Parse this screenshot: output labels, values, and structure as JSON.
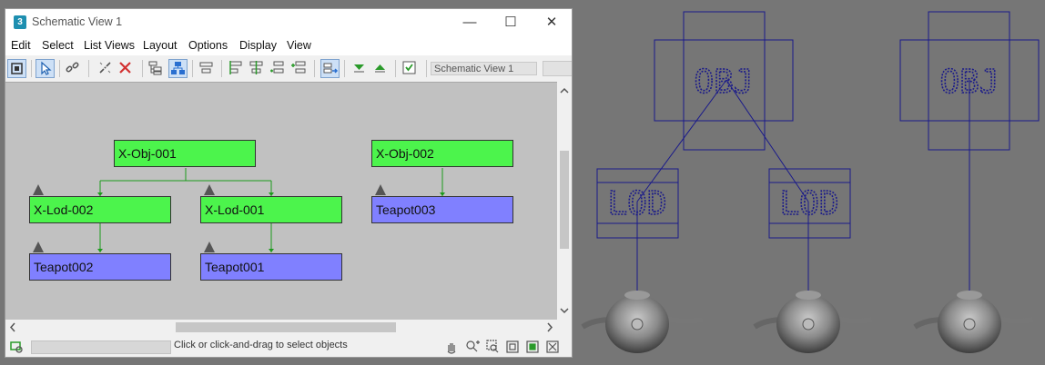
{
  "window": {
    "title": "Schematic View 1",
    "app_icon_label": "3",
    "minimize_glyph": "—",
    "maximize_glyph": "☐",
    "close_glyph": "✕"
  },
  "menu": [
    "Edit",
    "Select",
    "List Views",
    "Layout",
    "Options",
    "Display",
    "View"
  ],
  "toolbar": {
    "view_name": "Schematic View 1",
    "buttons": [
      "display-floater-icon",
      "select-icon",
      "connect-icon",
      "unlink-icon",
      "delete-icon",
      "hierarchy-mode-icon",
      "references-mode-icon",
      "align-icon",
      "align-left-icon",
      "align-center-icon",
      "insert-branch-icon",
      "insert-node-icon",
      "preferences-icon",
      "expand-icon",
      "collapse-icon",
      "filter-icon"
    ]
  },
  "schematic": {
    "nodes": [
      {
        "id": "x-obj-001",
        "label": "X-Obj-001",
        "kind": "object"
      },
      {
        "id": "x-lod-002",
        "label": "X-Lod-002",
        "kind": "object"
      },
      {
        "id": "x-lod-001",
        "label": "X-Lod-001",
        "kind": "object"
      },
      {
        "id": "teapot002",
        "label": "Teapot002",
        "kind": "geometry"
      },
      {
        "id": "teapot001",
        "label": "Teapot001",
        "kind": "geometry"
      },
      {
        "id": "x-obj-002",
        "label": "X-Obj-002",
        "kind": "object"
      },
      {
        "id": "teapot003",
        "label": "Teapot003",
        "kind": "geometry"
      }
    ],
    "colors": {
      "object": "#4cf44c",
      "geometry": "#8080ff",
      "wire": "#1c9a1c",
      "background": "#c1c1c1"
    }
  },
  "status": {
    "message": "Click or click-and-drag to select objects",
    "tools": [
      "pan-icon",
      "zoom-icon",
      "zoom-region-icon",
      "zoom-extents-icon",
      "zoom-extents-selected-icon",
      "maximize-viewport-icon"
    ]
  },
  "viewport": {
    "helper_labels": {
      "obj": "OBJ",
      "lod": "LOD"
    },
    "colors": {
      "background": "#767676",
      "helper": "#1a1a8a"
    }
  }
}
